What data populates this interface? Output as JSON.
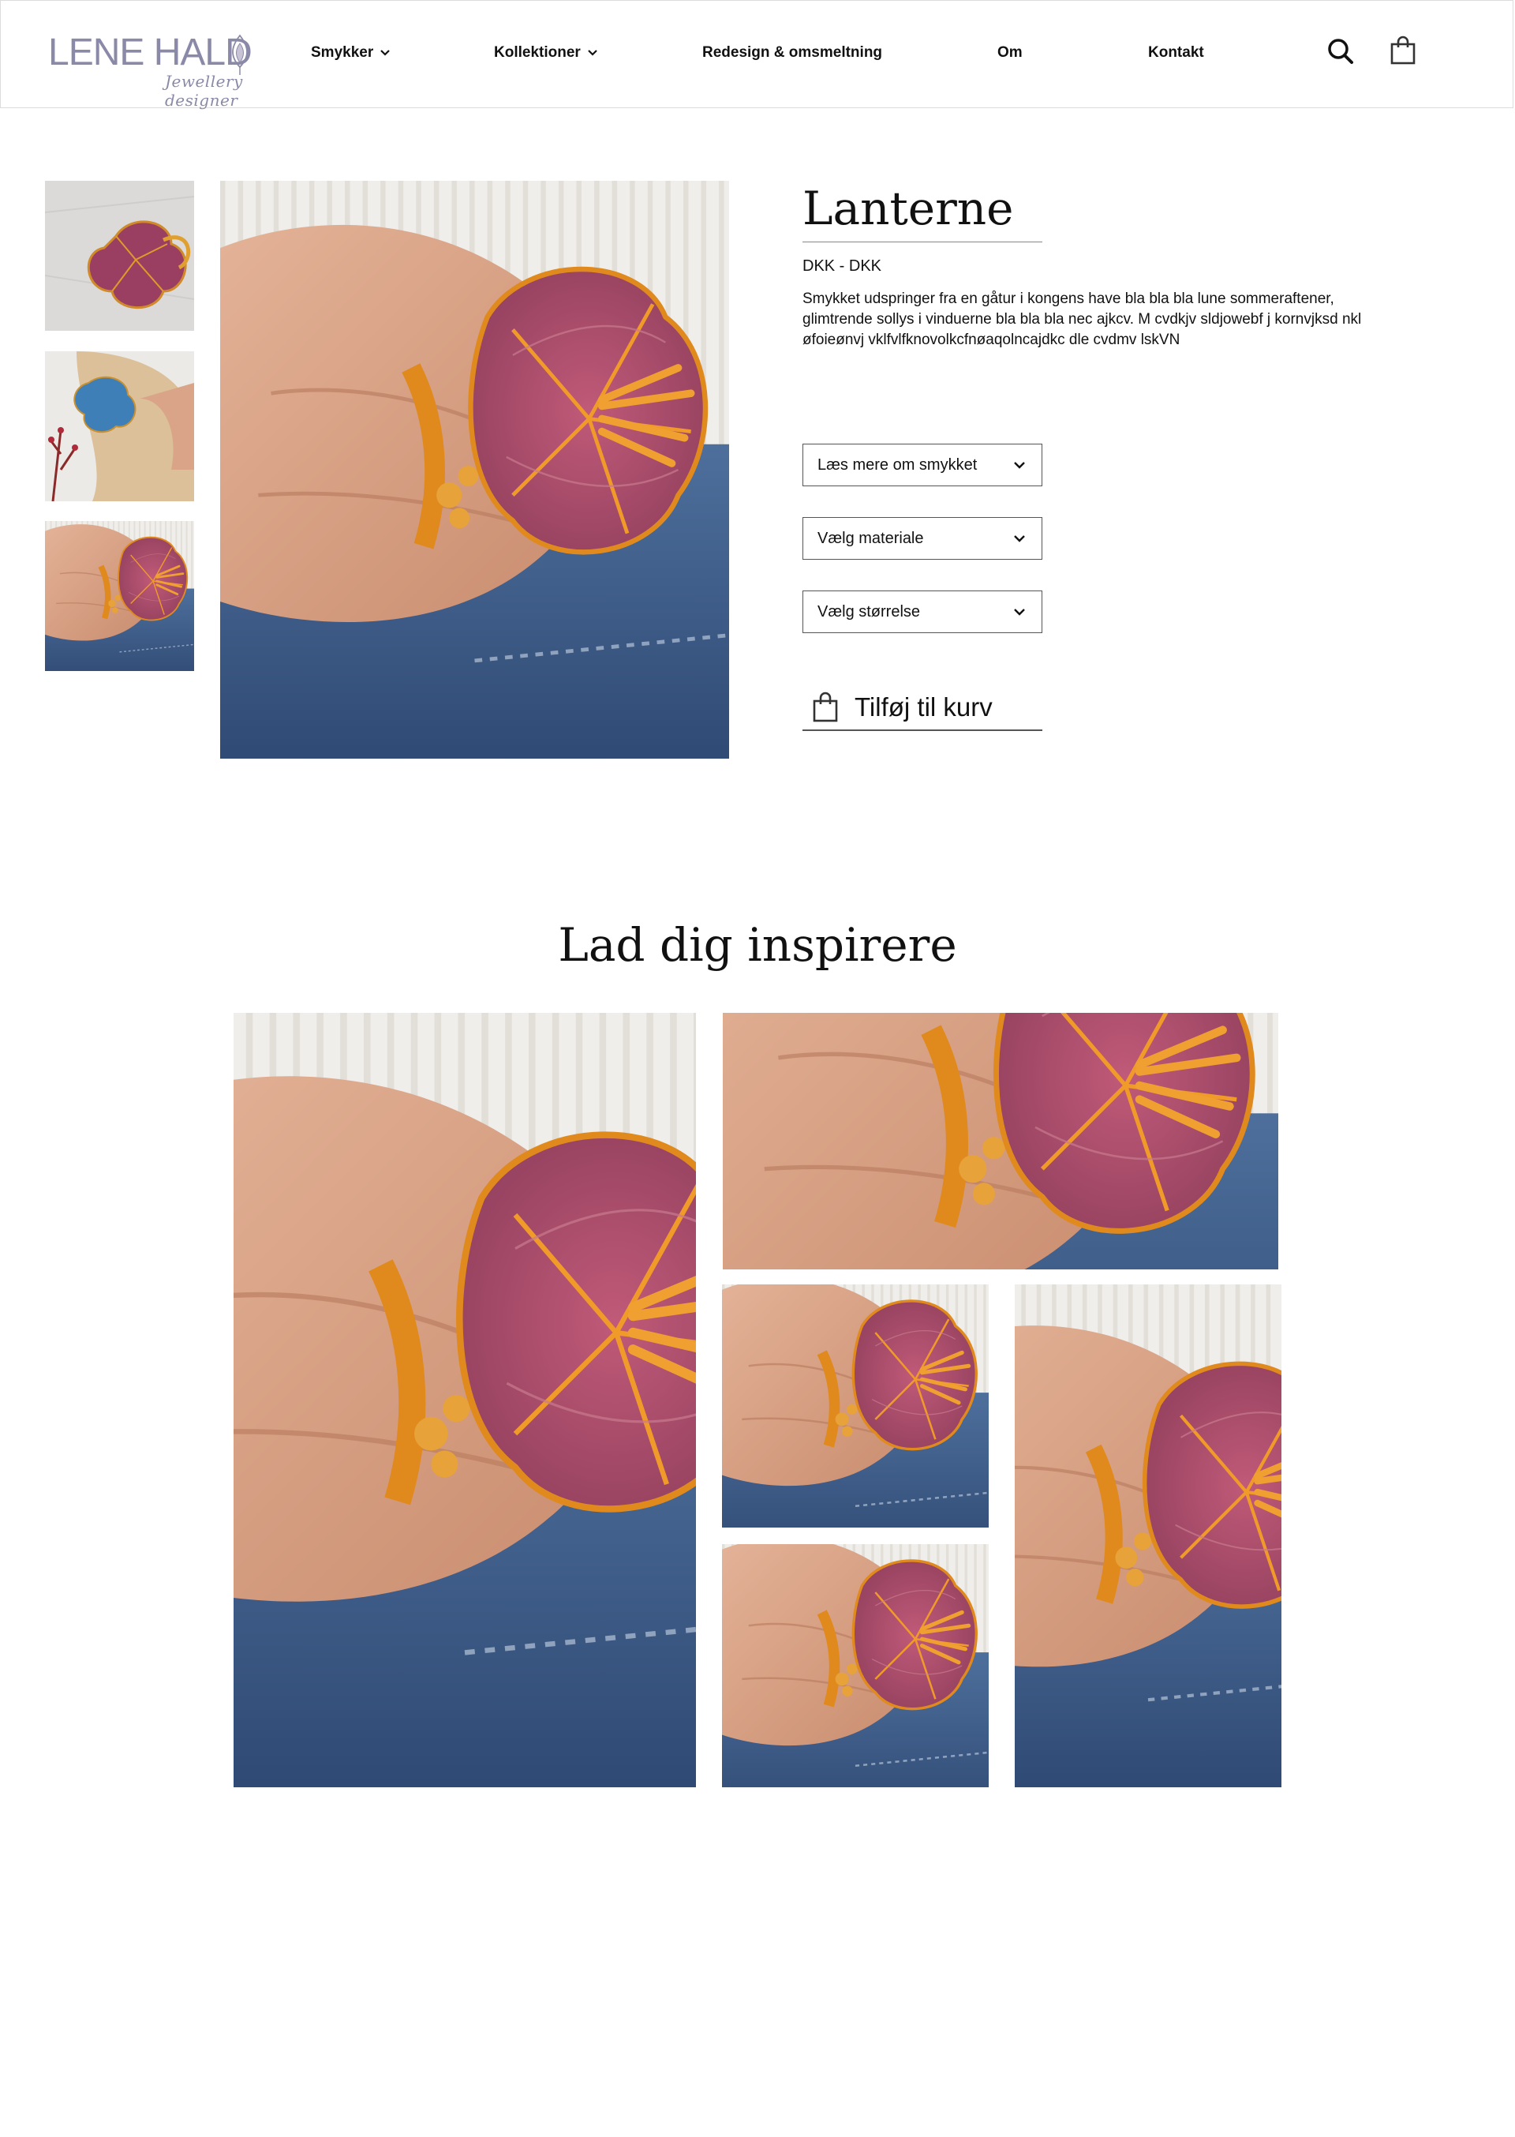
{
  "brand": {
    "name": "LENE HALD",
    "tagline": "Jewellery designer"
  },
  "nav": {
    "items": [
      {
        "label": "Smykker",
        "has_dropdown": true
      },
      {
        "label": "Kollektioner",
        "has_dropdown": true
      },
      {
        "label": "Redesign & omsmeltning",
        "has_dropdown": false
      },
      {
        "label": "Om",
        "has_dropdown": false
      },
      {
        "label": "Kontakt",
        "has_dropdown": false
      }
    ],
    "icons": [
      "search-icon",
      "shopping-bag-icon"
    ]
  },
  "product": {
    "title": "Lanterne",
    "price": "DKK - DKK",
    "description": "Smykket udspringer fra en  gåtur i kongens have bla bla bla lune sommeraftener, glimtrende sollys i vinduerne bla bla bla nec ajkcv. M cvdkjv sldjowebf j kornvjksd nkl øfoieønvj vklfvlfknovolkcfnøaqolncajdkc dle  cvdmv lskVN",
    "selects": [
      {
        "label": "Læs mere om smykket"
      },
      {
        "label": "Vælg materiale"
      },
      {
        "label": "Vælg størrelse"
      }
    ],
    "add_to_cart": "Tilføj til kurv",
    "thumbnails": [
      "pink-ring-on-marble",
      "blue-ring-model-hair",
      "pink-ring-on-hand"
    ]
  },
  "inspiration": {
    "title": "Lad dig inspirere"
  },
  "colors": {
    "accent_logo": "#8a8aa8",
    "ring_pink": "#b0506c",
    "ring_gold": "#e08a1e",
    "denim": "#3d5f8f",
    "skin": "#d9a487",
    "knit": "#efedea"
  }
}
